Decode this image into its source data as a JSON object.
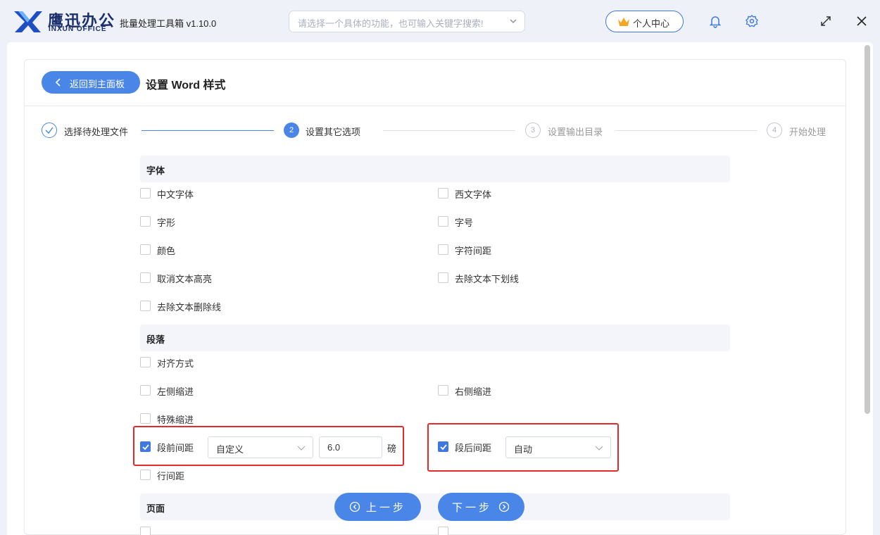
{
  "titlebar": {
    "brand_cn": "鹰迅办公",
    "brand_en": "INXUN OFFICE",
    "app_title": "批量处理工具箱 v1.10.0",
    "search_placeholder": "请选择一个具体的功能，也可输入关键字搜索!",
    "user_center": "个人中心"
  },
  "header": {
    "back_label": "返回到主面板",
    "page_title": "设置 Word 样式"
  },
  "steps": [
    {
      "number": "✓",
      "label": "选择待处理文件"
    },
    {
      "number": "2",
      "label": "设置其它选项"
    },
    {
      "number": "3",
      "label": "设置输出目录"
    },
    {
      "number": "4",
      "label": "开始处理"
    }
  ],
  "sections": {
    "font": {
      "title": "字体",
      "options": [
        "中文字体",
        "西文字体",
        "字形",
        "字号",
        "颜色",
        "字符间距",
        "取消文本高亮",
        "去除文本下划线",
        "去除文本删除线"
      ]
    },
    "paragraph": {
      "title": "段落",
      "options": [
        "对齐方式",
        "左侧缩进",
        "右侧缩进",
        "特殊缩进",
        "段前间距",
        "段后间距",
        "行间距"
      ],
      "space_before": {
        "mode": "自定义",
        "value": "6.0",
        "unit": "磅"
      },
      "space_after": {
        "mode": "自动"
      }
    },
    "page": {
      "title": "页面"
    }
  },
  "nav": {
    "prev_label": "上一步",
    "next_label": "下一步"
  },
  "colors": {
    "accent": "#4a86e8",
    "highlight": "#e32b2b"
  }
}
